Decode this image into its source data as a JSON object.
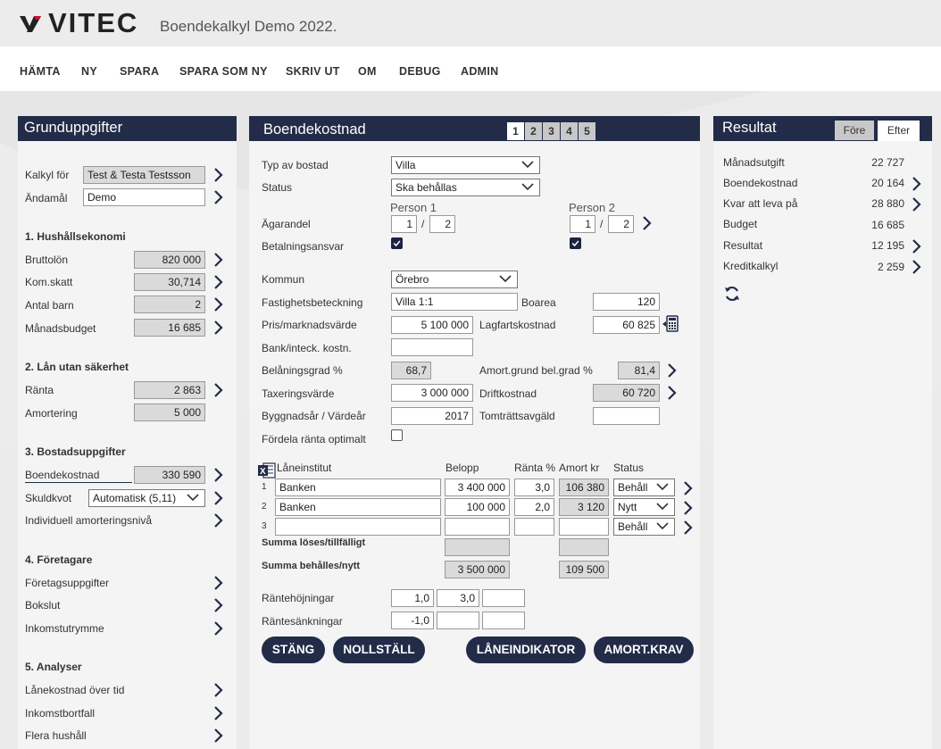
{
  "header": {
    "brand": "VITEC",
    "app_title": "Boendekalkyl Demo 2022."
  },
  "nav": [
    "HÄMTA",
    "NY",
    "SPARA",
    "SPARA SOM NY",
    "SKRIV UT",
    "OM",
    "DEBUG",
    "ADMIN"
  ],
  "left": {
    "title": "Grunduppgifter",
    "kalkyl_for_label": "Kalkyl för",
    "kalkyl_for_value": "Test & Testa Testsson",
    "andamal_label": "Ändamål",
    "andamal_value": "Demo",
    "s1": "1. Hushållsekonomi",
    "bruttolon_label": "Bruttolön",
    "bruttolon_value": "820 000",
    "komskatt_label": "Kom.skatt",
    "komskatt_value": "30,714",
    "antalbarn_label": "Antal barn",
    "antalbarn_value": "2",
    "manadsbudget_label": "Månadsbudget",
    "manadsbudget_value": "16 685",
    "s2": "2. Lån utan säkerhet",
    "ranta_label": "Ränta",
    "ranta_value": "2 863",
    "amortering_label": "Amortering",
    "amortering_value": "5 000",
    "s3": "3. Bostadsuppgifter",
    "boendekostnad_label": "Boendekostnad",
    "boendekostnad_value": "330 590",
    "skuldkvot_label": "Skuldkvot",
    "skuldkvot_value": "Automatisk (5,11)",
    "individuell_label": "Individuell amorteringsnivå",
    "s4": "4. Företagare",
    "foretagsuppgifter_label": "Företagsuppgifter",
    "bokslut_label": "Bokslut",
    "inkomstutrymme_label": "Inkomstutrymme",
    "s5": "5. Analyser",
    "lanekostnad_label": "Lånekostnad över tid",
    "inkomstbortfall_label": "Inkomstbortfall",
    "flerahushall_label": "Flera hushåll"
  },
  "middle": {
    "title": "Boendekostnad",
    "tabs": [
      "1",
      "2",
      "3",
      "4",
      "5"
    ],
    "typ_label": "Typ av bostad",
    "typ_value": "Villa",
    "status_label": "Status",
    "status_value": "Ska behållas",
    "person1": "Person 1",
    "person2": "Person 2",
    "agarandel_label": "Ägarandel",
    "p1_num": "1",
    "p1_den": "2",
    "p2_num": "1",
    "p2_den": "2",
    "slash": "/",
    "betalning_label": "Betalningsansvar",
    "kommun_label": "Kommun",
    "kommun_value": "Örebro",
    "fastighet_label": "Fastighetsbeteckning",
    "fastighet_value": "Villa 1:1",
    "boarea_label": "Boarea",
    "boarea_value": "120",
    "pris_label": "Pris/marknadsvärde",
    "pris_value": "5 100 000",
    "lagfart_label": "Lagfartskostnad",
    "lagfart_value": "60 825",
    "bank_label": "Bank/inteck. kostn.",
    "bank_value": "",
    "belaning_label": "Belåningsgrad %",
    "belaning_value": "68,7",
    "amortgrund_label": "Amort.grund bel.grad %",
    "amortgrund_value": "81,4",
    "taxering_label": "Taxeringsvärde",
    "taxering_value": "3 000 000",
    "drift_label": "Driftkostnad",
    "drift_value": "60 720",
    "byggnadsar_label": "Byggnadsår / Värdeår",
    "byggnadsar_value": "2017",
    "tomtratt_label": "Tomträttsavgäld",
    "tomtratt_value": "",
    "fordela_label": "Fördela ränta optimalt",
    "loan_headers": {
      "institut": "Låneinstitut",
      "belopp": "Belopp",
      "ranta": "Ränta %",
      "amort": "Amort kr",
      "status": "Status"
    },
    "loans": [
      {
        "nr": "1",
        "institut": "Banken",
        "belopp": "3 400 000",
        "ranta": "3,0",
        "amort": "106 380",
        "status": "Behåll"
      },
      {
        "nr": "2",
        "institut": "Banken",
        "belopp": "100 000",
        "ranta": "2,0",
        "amort": "3 120",
        "status": "Nytt"
      },
      {
        "nr": "3",
        "institut": "",
        "belopp": "",
        "ranta": "",
        "amort": "",
        "status": "Behåll"
      }
    ],
    "summa_loses_label": "Summa löses/tillfälligt",
    "summa_behalles_label": "Summa behålles/nytt",
    "summa_behalles_belopp": "3 500 000",
    "summa_behalles_amort": "109 500",
    "rantehojning_label": "Räntehöjningar",
    "rantehojning_1": "1,0",
    "rantehojning_2": "3,0",
    "rantesankning_label": "Räntesänkningar",
    "rantesankning_1": "-1,0",
    "buttons": {
      "stang": "STÄNG",
      "nollstall": "NOLLSTÄLL",
      "laneindikator": "LÅNEINDIKATOR",
      "amortkrav": "AMORT.KRAV"
    }
  },
  "right": {
    "title": "Resultat",
    "tab_fore": "Före",
    "tab_efter": "Efter",
    "rows": [
      {
        "label": "Månadsutgift",
        "value": "22 727"
      },
      {
        "label": "Boendekostnad",
        "value": "20 164"
      },
      {
        "label": "Kvar att leva på",
        "value": "28 880"
      },
      {
        "label": "Budget",
        "value": "16 685"
      },
      {
        "label": "Resultat",
        "value": "12 195"
      },
      {
        "label": "Kreditkalkyl",
        "value": "2 259"
      }
    ]
  },
  "colors": {
    "navy": "#222c48",
    "gray_field": "#dadada",
    "panel": "#f4f4f4"
  }
}
